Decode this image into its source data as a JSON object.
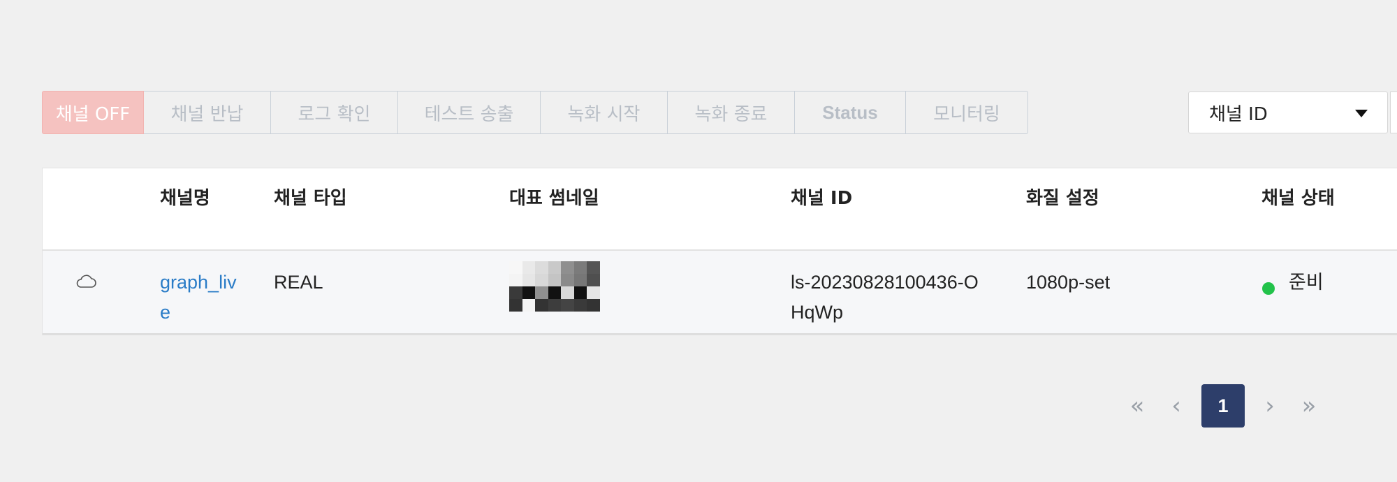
{
  "toolbar": {
    "buttons": [
      "채널 OFF",
      "채널 반납",
      "로그 확인",
      "테스트 송출",
      "녹화 시작",
      "녹화 종료",
      "Status",
      "모니터링"
    ]
  },
  "filter": {
    "selected": "채널 ID"
  },
  "table": {
    "headers": [
      "채널명",
      "채널 타입",
      "대표 썸네일",
      "채널 ID",
      "화질 설정",
      "채널 상태"
    ],
    "rows": [
      {
        "name_line1": "graph_liv",
        "name_line2": "e",
        "type": "REAL",
        "id_line1": "ls-20230828100436-O",
        "id_line2": "HqWp",
        "quality": "1080p-set",
        "status": "준비"
      }
    ]
  },
  "pagination": {
    "current": "1",
    "first": "«",
    "prev": "‹",
    "next": "›",
    "last": "»"
  },
  "colors": {
    "primary_off": "#f5c2c0",
    "link": "#2a7cc7",
    "status_ready": "#22c24a",
    "page_active": "#2d3e6a"
  }
}
